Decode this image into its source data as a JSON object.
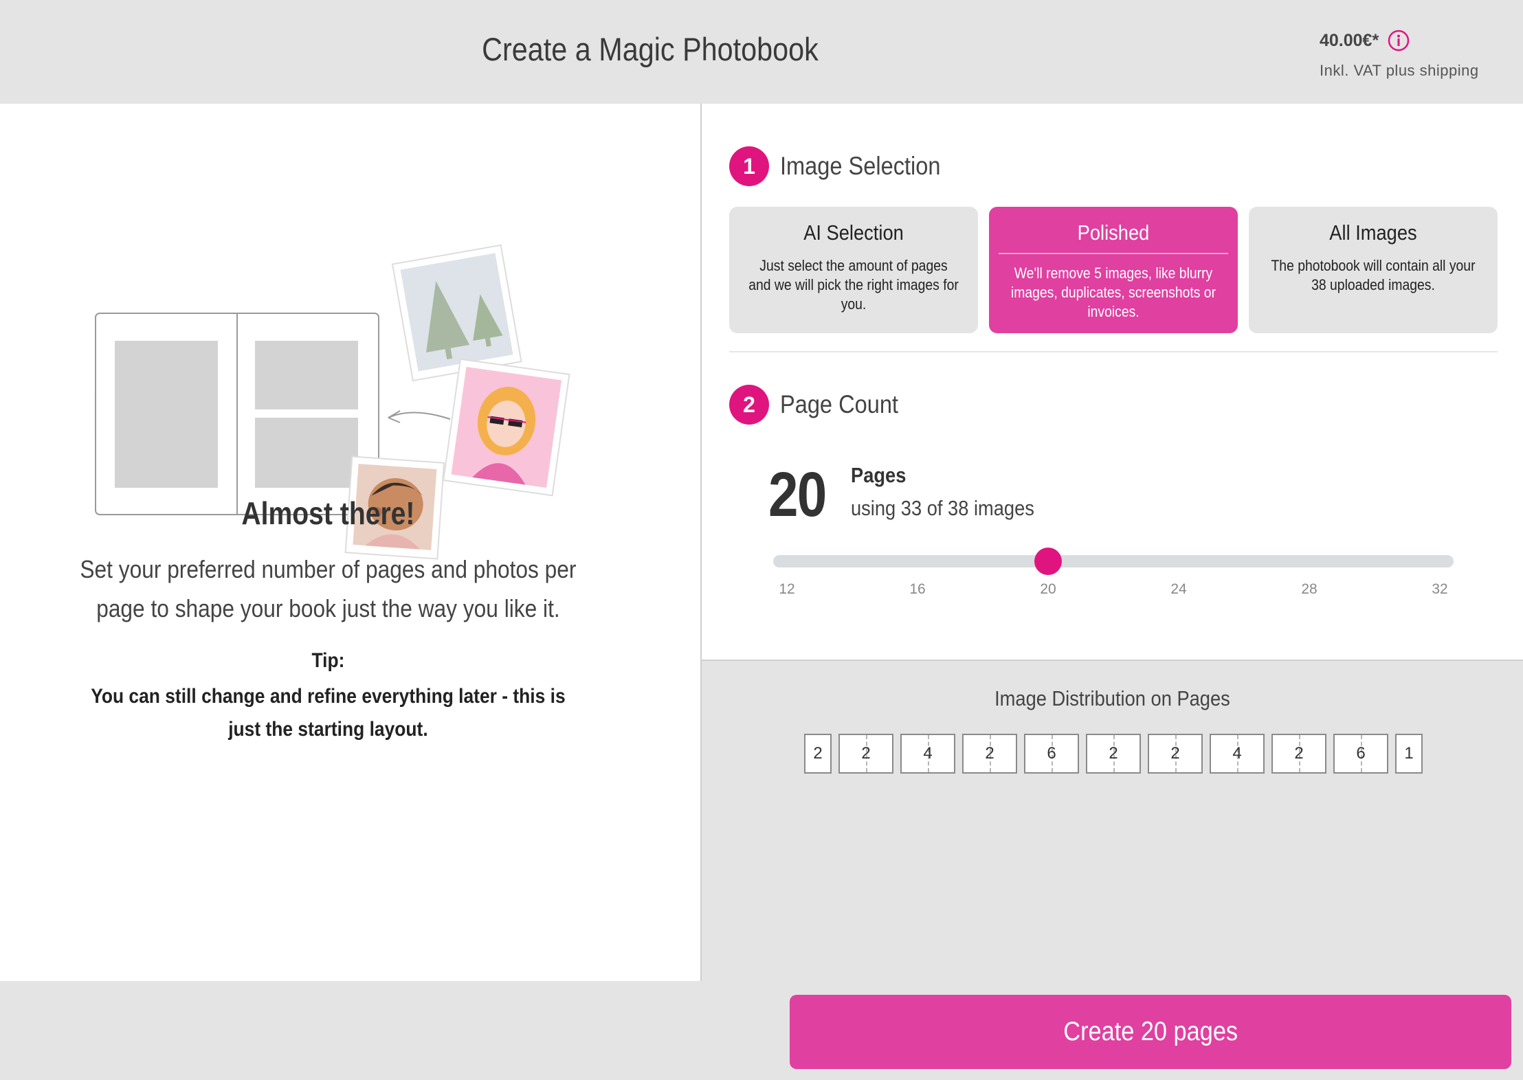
{
  "header": {
    "title": "Create a Magic Photobook",
    "price": "40.00€*",
    "vat_note": "Inkl. VAT plus shipping"
  },
  "left": {
    "heading": "Almost there!",
    "description": "Set your preferred number of pages and photos per page to shape your book just the way you like it.",
    "tip_label": "Tip:",
    "tip_text": "You can still change and refine everything later - this is just the starting layout."
  },
  "image_selection": {
    "step": "1",
    "title": "Image Selection",
    "options": [
      {
        "title": "AI Selection",
        "description": "Just select the amount of pages and we will pick the right images for you.",
        "selected": false
      },
      {
        "title": "Polished",
        "description": "We'll remove 5 images, like blurry images, duplicates, screenshots or invoices.",
        "selected": true
      },
      {
        "title": "All Images",
        "description": "The photobook will contain all your 38 uploaded images.",
        "selected": false
      }
    ]
  },
  "page_count": {
    "step": "2",
    "title": "Page Count",
    "value": "20",
    "unit_label": "Pages",
    "usage": "using 33 of 38 images",
    "slider": {
      "min": 12,
      "max": 32,
      "value": 20,
      "ticks": [
        "12",
        "16",
        "20",
        "24",
        "28",
        "32"
      ]
    }
  },
  "distribution": {
    "title": "Image Distribution on Pages",
    "pages": [
      "2",
      "2",
      "4",
      "2",
      "6",
      "2",
      "2",
      "4",
      "2",
      "6",
      "1"
    ]
  },
  "footer": {
    "create_label": "Create 20 pages"
  },
  "colors": {
    "accent": "#e0147f",
    "accent_soft": "#e040a0",
    "panel_gray": "#e4e4e4"
  }
}
